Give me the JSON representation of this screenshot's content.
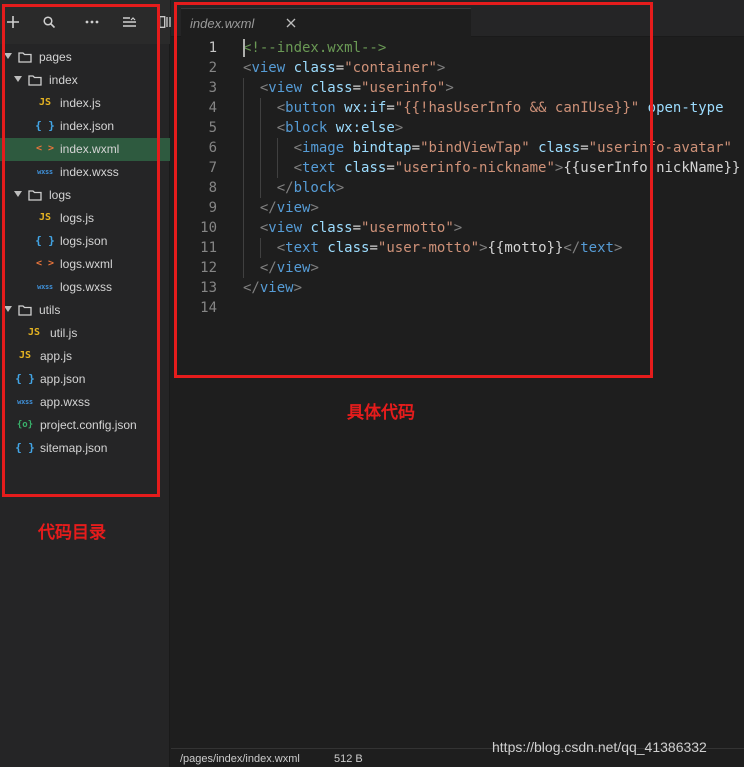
{
  "sidebar": {
    "toolbar": [
      "add-icon",
      "search-icon",
      "more-icon",
      "collapse-icon",
      "split-icon"
    ],
    "tree": [
      {
        "label": "pages",
        "kind": "folder",
        "open": true
      },
      {
        "label": "index",
        "kind": "folder",
        "open": true
      },
      {
        "label": "index.js",
        "kind": "js",
        "icon_text": "JS"
      },
      {
        "label": "index.json",
        "kind": "json",
        "icon_text": "{ }"
      },
      {
        "label": "index.wxml",
        "kind": "wxml",
        "icon_text": "< >",
        "selected": true
      },
      {
        "label": "index.wxss",
        "kind": "wxss",
        "icon_text": "wxss"
      },
      {
        "label": "logs",
        "kind": "folder",
        "open": true
      },
      {
        "label": "logs.js",
        "kind": "js",
        "icon_text": "JS"
      },
      {
        "label": "logs.json",
        "kind": "json",
        "icon_text": "{ }"
      },
      {
        "label": "logs.wxml",
        "kind": "wxml",
        "icon_text": "< >"
      },
      {
        "label": "logs.wxss",
        "kind": "wxss",
        "icon_text": "wxss"
      },
      {
        "label": "utils",
        "kind": "folder",
        "open": true
      },
      {
        "label": "util.js",
        "kind": "js",
        "icon_text": "JS"
      },
      {
        "label": "app.js",
        "kind": "js",
        "icon_text": "JS"
      },
      {
        "label": "app.json",
        "kind": "json",
        "icon_text": "{ }"
      },
      {
        "label": "app.wxss",
        "kind": "wxss",
        "icon_text": "wxss"
      },
      {
        "label": "project.config.json",
        "kind": "config",
        "icon_text": "{o}"
      },
      {
        "label": "sitemap.json",
        "kind": "json",
        "icon_text": "{ }"
      }
    ]
  },
  "editor": {
    "tab": {
      "label": "index.wxml",
      "close_icon": "close-icon"
    },
    "active_line": 1,
    "lines": [
      [
        [
          "cm",
          "<!--index.wxml-->"
        ]
      ],
      [
        [
          "br",
          "<"
        ],
        [
          "tag",
          "view"
        ],
        [
          "tx",
          " "
        ],
        [
          "at",
          "class"
        ],
        [
          "eq",
          "="
        ],
        [
          "st",
          "\"container\""
        ],
        [
          "br",
          ">"
        ]
      ],
      [
        [
          "tx",
          "  "
        ],
        [
          "br",
          "<"
        ],
        [
          "tag",
          "view"
        ],
        [
          "tx",
          " "
        ],
        [
          "at",
          "class"
        ],
        [
          "eq",
          "="
        ],
        [
          "st",
          "\"userinfo\""
        ],
        [
          "br",
          ">"
        ]
      ],
      [
        [
          "tx",
          "    "
        ],
        [
          "br",
          "<"
        ],
        [
          "tag",
          "button"
        ],
        [
          "tx",
          " "
        ],
        [
          "at",
          "wx:if"
        ],
        [
          "eq",
          "="
        ],
        [
          "st",
          "\"{{!hasUserInfo && canIUse}}\""
        ],
        [
          "tx",
          " "
        ],
        [
          "at",
          "open-type"
        ]
      ],
      [
        [
          "tx",
          "    "
        ],
        [
          "br",
          "<"
        ],
        [
          "tag",
          "block"
        ],
        [
          "tx",
          " "
        ],
        [
          "at",
          "wx:else"
        ],
        [
          "br",
          ">"
        ]
      ],
      [
        [
          "tx",
          "      "
        ],
        [
          "br",
          "<"
        ],
        [
          "tag",
          "image"
        ],
        [
          "tx",
          " "
        ],
        [
          "at",
          "bindtap"
        ],
        [
          "eq",
          "="
        ],
        [
          "st",
          "\"bindViewTap\""
        ],
        [
          "tx",
          " "
        ],
        [
          "at",
          "class"
        ],
        [
          "eq",
          "="
        ],
        [
          "st",
          "\"userinfo-avatar\""
        ]
      ],
      [
        [
          "tx",
          "      "
        ],
        [
          "br",
          "<"
        ],
        [
          "tag",
          "text"
        ],
        [
          "tx",
          " "
        ],
        [
          "at",
          "class"
        ],
        [
          "eq",
          "="
        ],
        [
          "st",
          "\"userinfo-nickname\""
        ],
        [
          "br",
          ">"
        ],
        [
          "tx",
          "{{userInfo.nickName}}"
        ]
      ],
      [
        [
          "tx",
          "    "
        ],
        [
          "br",
          "</"
        ],
        [
          "tag",
          "block"
        ],
        [
          "br",
          ">"
        ]
      ],
      [
        [
          "tx",
          "  "
        ],
        [
          "br",
          "</"
        ],
        [
          "tag",
          "view"
        ],
        [
          "br",
          ">"
        ]
      ],
      [
        [
          "tx",
          "  "
        ],
        [
          "br",
          "<"
        ],
        [
          "tag",
          "view"
        ],
        [
          "tx",
          " "
        ],
        [
          "at",
          "class"
        ],
        [
          "eq",
          "="
        ],
        [
          "st",
          "\"usermotto\""
        ],
        [
          "br",
          ">"
        ]
      ],
      [
        [
          "tx",
          "    "
        ],
        [
          "br",
          "<"
        ],
        [
          "tag",
          "text"
        ],
        [
          "tx",
          " "
        ],
        [
          "at",
          "class"
        ],
        [
          "eq",
          "="
        ],
        [
          "st",
          "\"user-motto\""
        ],
        [
          "br",
          ">"
        ],
        [
          "tx",
          "{{motto}}"
        ],
        [
          "br",
          "</"
        ],
        [
          "tag",
          "text"
        ],
        [
          "br",
          ">"
        ]
      ],
      [
        [
          "tx",
          "  "
        ],
        [
          "br",
          "</"
        ],
        [
          "tag",
          "view"
        ],
        [
          "br",
          ">"
        ]
      ],
      [
        [
          "br",
          "</"
        ],
        [
          "tag",
          "view"
        ],
        [
          "br",
          ">"
        ]
      ],
      []
    ]
  },
  "status": {
    "path": "/pages/index/index.wxml",
    "size": "512 B"
  },
  "annotations": {
    "code_label": "具体代码",
    "tree_label": "代码目录",
    "color": "#e51c1c"
  },
  "watermark": "https://blog.csdn.net/qq_41386332"
}
